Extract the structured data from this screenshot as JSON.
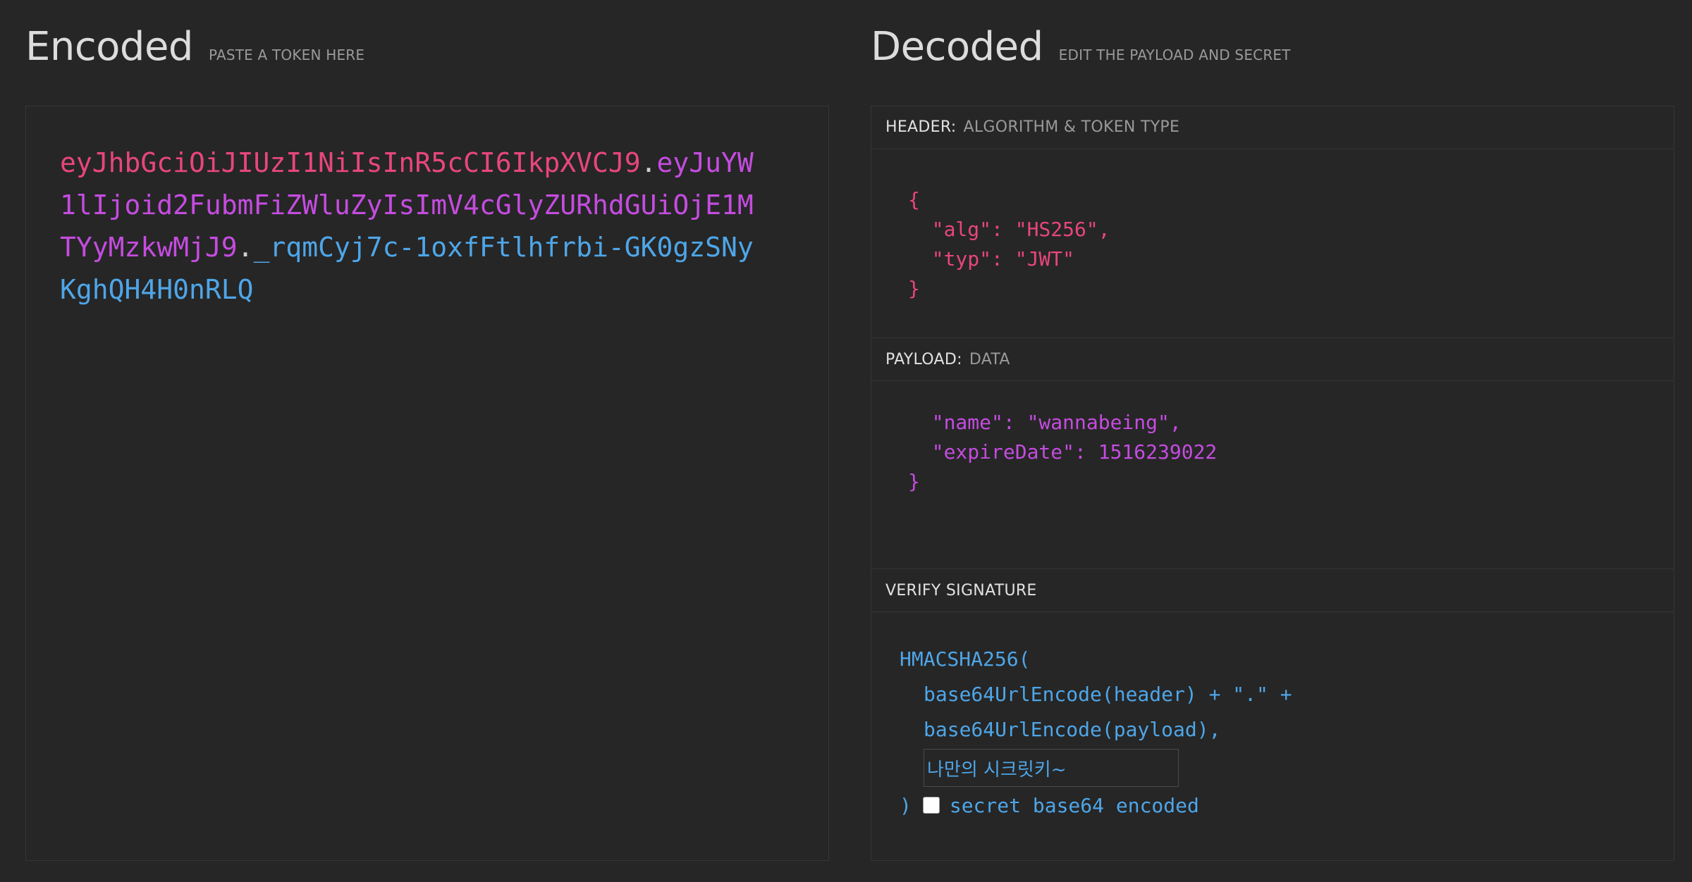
{
  "encoded": {
    "title": "Encoded",
    "subtitle": "PASTE A TOKEN HERE",
    "token": {
      "header": "eyJhbGciOiJIUzI1NiIsInR5cCI6IkpXVCJ9",
      "dot": ".",
      "payload": "eyJuYW1lIjoid2FubmFiZWluZyIsImV4cGlyZURhdGUiOjE1MTYyMzkwMjJ9",
      "signature": "_rqmCyj7c-1oxfFtlhfrbi-GK0gzSNyKghQH4H0nRLQ"
    }
  },
  "decoded": {
    "title": "Decoded",
    "subtitle": "EDIT THE PAYLOAD AND SECRET",
    "header_section": {
      "label": "HEADER:",
      "sublabel": "ALGORITHM & TOKEN TYPE",
      "code": "{\n  \"alg\": \"HS256\",\n  \"typ\": \"JWT\"\n}"
    },
    "payload_section": {
      "label": "PAYLOAD:",
      "sublabel": "DATA",
      "code": "  \"name\": \"wannabeing\",\n  \"expireDate\": 1516239022\n}"
    },
    "signature_section": {
      "label": "VERIFY SIGNATURE",
      "fn_open": "HMACSHA256(",
      "line1": "base64UrlEncode(header) + \".\" +",
      "line2": "base64UrlEncode(payload),",
      "secret_value": "나만의 시크릿키~",
      "close": ")",
      "checkbox_label": "secret base64 encoded",
      "checkbox_checked": false
    }
  },
  "colors": {
    "header": "#e8467c",
    "payload": "#c54ce0",
    "signature": "#4ea6e8",
    "background": "#262626"
  }
}
